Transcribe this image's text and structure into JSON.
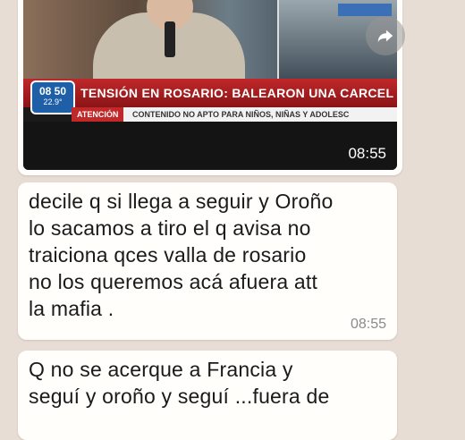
{
  "video_message": {
    "ticker_headline": "TENSIÓN EN ROSARIO: BALEARON UNA CARCEL",
    "channel_clock": "08 50",
    "channel_temp": "22.9°",
    "warning_label": "ATENCIÓN",
    "warning_text": "CONTENIDO NO APTO PARA NIÑOS, NIÑAS Y ADOLESC",
    "time": "08:55"
  },
  "messages": [
    {
      "text": "decile q si llega a seguir y Oroño\nlo sacamos a tiro el q avisa no\ntraiciona qces valla de rosario\nno los queremos acá afuera att\nla mafia .",
      "time": "08:55"
    },
    {
      "text": "Q no se acerque a Francia y\nseguí y oroño y seguí ...fuera de"
    }
  ],
  "forward_icon": "forward-arrow-icon"
}
